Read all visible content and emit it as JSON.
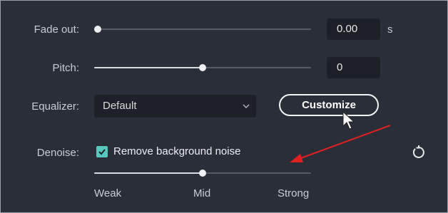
{
  "fade_out": {
    "label": "Fade out:",
    "value": "0.00",
    "unit": "s",
    "slider_fraction": 0.0
  },
  "pitch": {
    "label": "Pitch:",
    "value": "0",
    "slider_fraction": 0.5
  },
  "equalizer": {
    "label": "Equalizer:",
    "selected": "Default",
    "customize_label": "Customize"
  },
  "denoise": {
    "label": "Denoise:",
    "checkbox_label": "Remove background noise",
    "checked": true,
    "level_fraction": 0.5,
    "ticks": [
      "Weak",
      "Mid",
      "Strong"
    ]
  },
  "icons": {
    "dropdown": "chevron-down-icon",
    "reset": "reset-icon",
    "cursor": "mouse-cursor-icon",
    "annotation": "red-arrow-annotation"
  },
  "colors": {
    "background": "#2a2e38",
    "accent": "#59c8bc",
    "annotation": "#e02020"
  }
}
